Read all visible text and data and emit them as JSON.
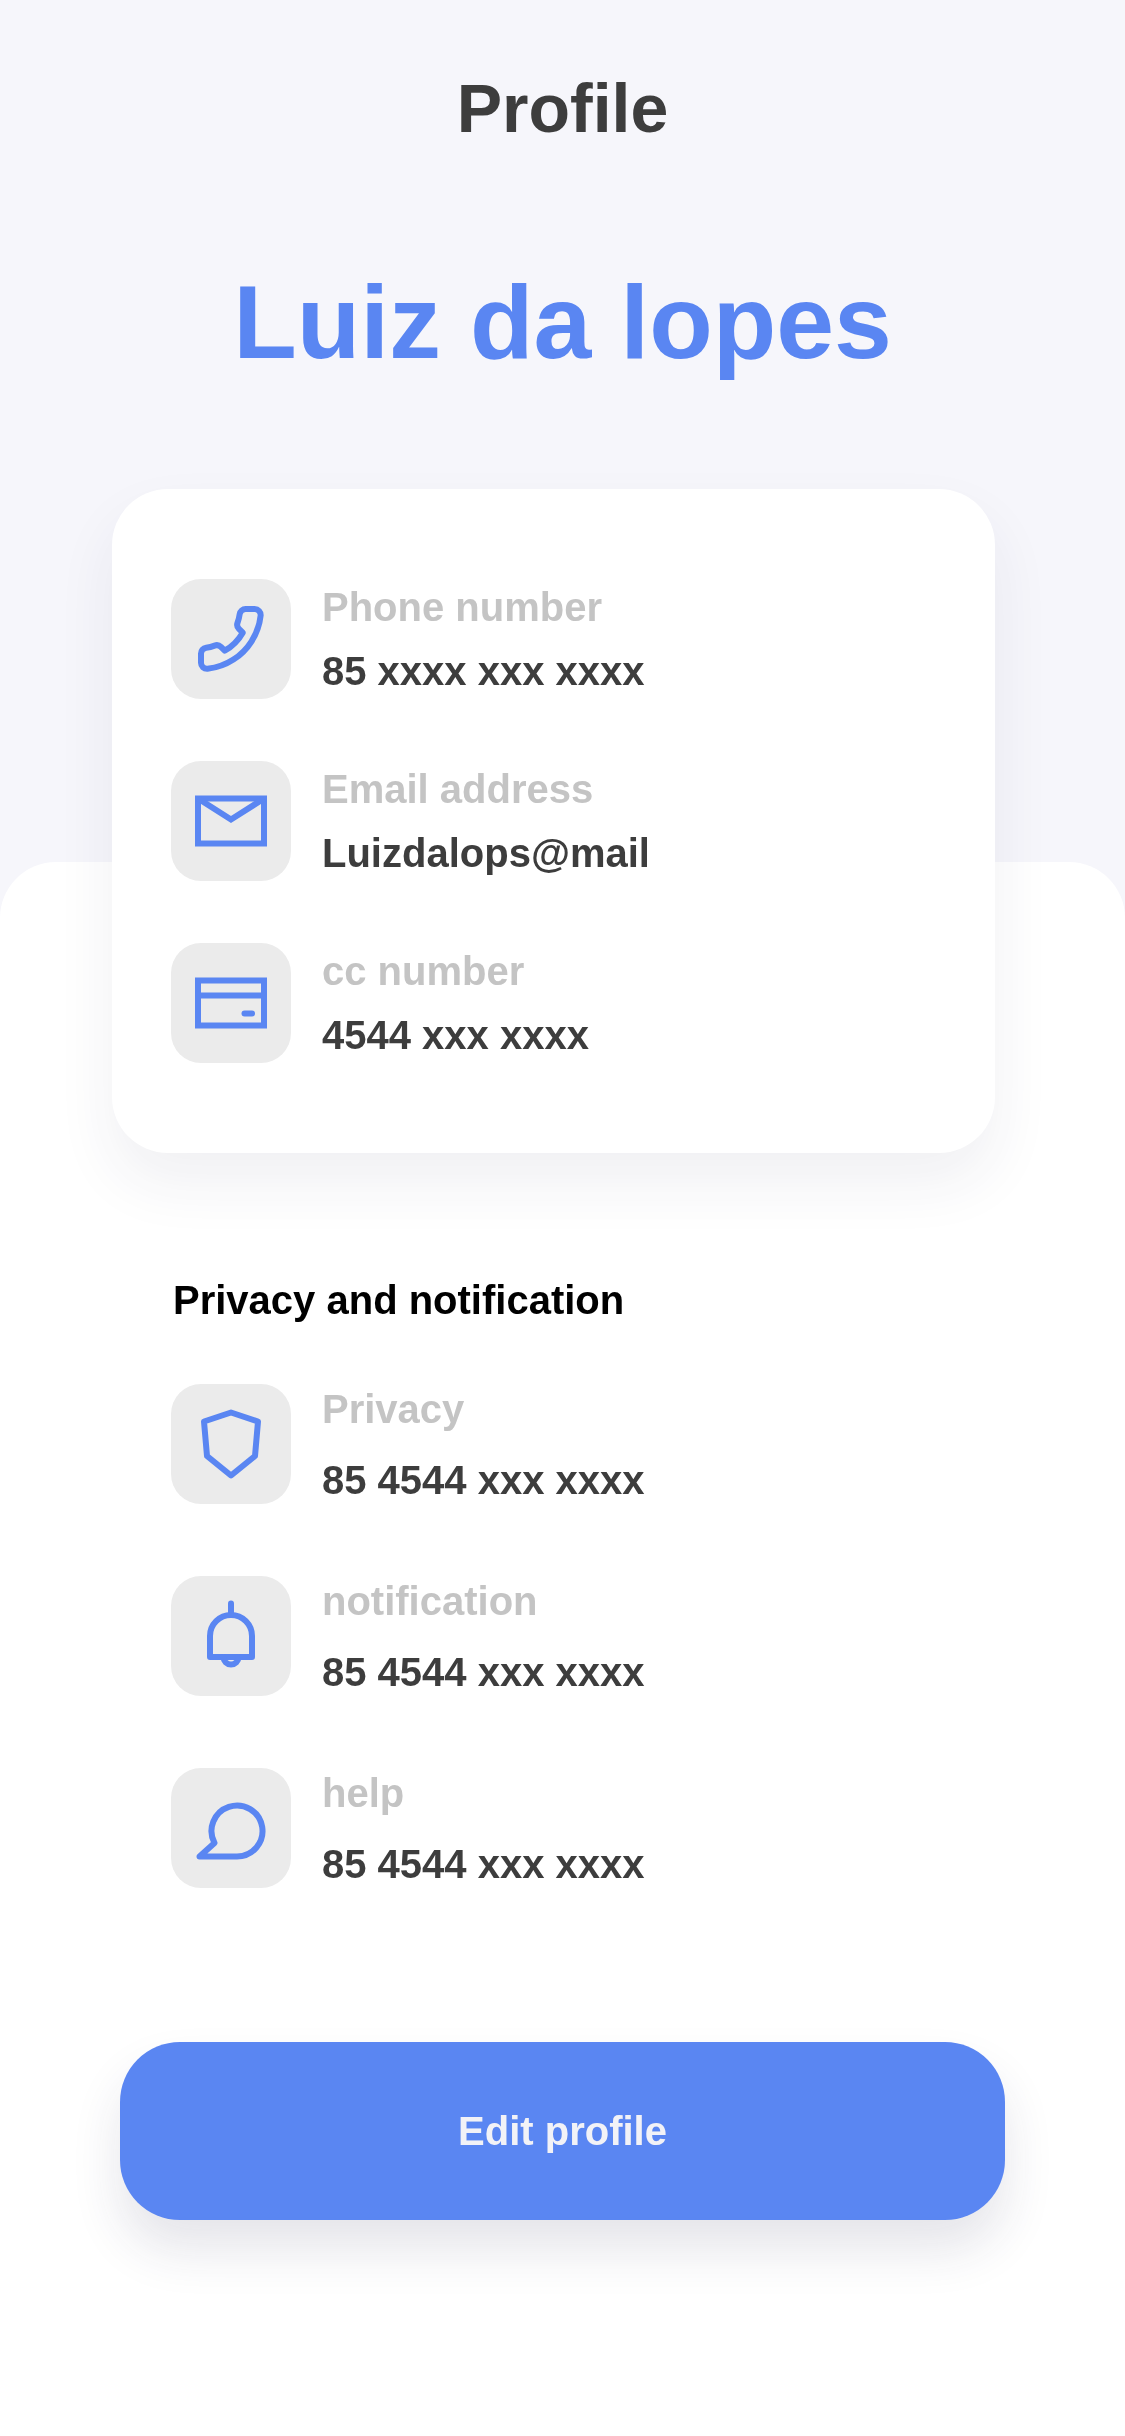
{
  "header": {
    "title": "Profile"
  },
  "profile": {
    "name": "Luiz da lopes"
  },
  "contact_card": {
    "items": [
      {
        "kind": "phone",
        "label": "Phone number",
        "value": "85 xxxx xxx xxxx"
      },
      {
        "kind": "email",
        "label": "Email address",
        "value": "Luizdalops@mail"
      },
      {
        "kind": "card",
        "label": "cc number",
        "value": "4544 xxx xxxx"
      }
    ]
  },
  "privacy_section": {
    "title": "Privacy and notification",
    "items": [
      {
        "kind": "privacy",
        "label": "Privacy",
        "value": "85 4544 xxx xxxx"
      },
      {
        "kind": "notification",
        "label": "notification",
        "value": "85 4544 xxx xxxx"
      },
      {
        "kind": "help",
        "label": "help",
        "value": "85 4544 xxx xxxx"
      }
    ]
  },
  "edit_button": {
    "label": "Edit profile"
  }
}
